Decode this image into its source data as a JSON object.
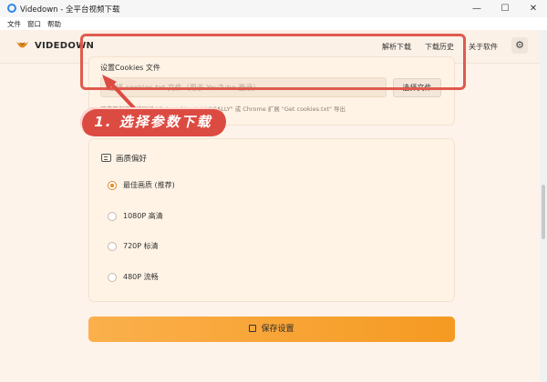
{
  "window": {
    "title": "Videdown - 全平台视频下载",
    "minimize": "—",
    "maximize": "☐",
    "close": "✕"
  },
  "menubar": {
    "items": [
      "文件",
      "窗口",
      "帮助"
    ]
  },
  "header": {
    "brand": "VIDEDOWN",
    "nav": [
      "解析下载",
      "下载历史",
      "关于软件"
    ],
    "settings_icon": "gear-icon"
  },
  "cookies": {
    "label": "设置Cookies 文件",
    "placeholder": "选择 cookies.txt 文件（用于 YouTube 登录）",
    "choose_button": "选择文件",
    "hint": "可使用浏览器扩展如 \"Get cookies.txt LOCALLY\" 或 Chrome 扩展 \"Get cookies.txt\" 导出"
  },
  "annotation": {
    "step_label": "1. 选择参数下载",
    "color": "#dc4b42"
  },
  "quality": {
    "title": "画质偏好",
    "options": [
      {
        "label": "最佳画质 (推荐)",
        "selected": true
      },
      {
        "label": "1080P 高清",
        "selected": false
      },
      {
        "label": "720P 标清",
        "selected": false
      },
      {
        "label": "480P 流畅",
        "selected": false
      }
    ]
  },
  "save_button": "保存设置",
  "colors": {
    "accent": "#f59a22",
    "background": "#fdf3ea",
    "highlight": "#e05a4e"
  }
}
